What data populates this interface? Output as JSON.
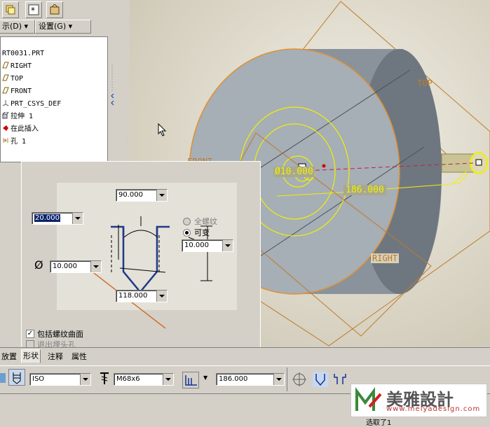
{
  "toolbar": {
    "display_menu": "示(D)",
    "settings_menu": "设置(G)"
  },
  "tree": {
    "items": [
      {
        "label": "RT0031.PRT",
        "icon": "part-icon"
      },
      {
        "label": "RIGHT",
        "icon": "datum-plane-icon"
      },
      {
        "label": "TOP",
        "icon": "datum-plane-icon"
      },
      {
        "label": "FRONT",
        "icon": "datum-plane-icon"
      },
      {
        "label": "PRT_CSYS_DEF",
        "icon": "csys-icon"
      },
      {
        "label": "拉伸 1",
        "icon": "extrude-icon"
      },
      {
        "label": "在此插入",
        "icon": "insert-arrow-icon"
      },
      {
        "label": "孔 1",
        "icon": "hole-icon"
      }
    ]
  },
  "model": {
    "datum_top": "TOP",
    "datum_front": "FRONT",
    "datum_right": "RIGHT",
    "dim_diameter": "Ø10.000",
    "dim_depth": "186.000"
  },
  "dialog": {
    "angle_value": "90.000",
    "thread_depth_value": "20.000",
    "radio_full_thread": "全螺纹",
    "radio_variable": "可变",
    "variable_value": "10.000",
    "diameter_symbol": "Ø",
    "diameter_value": "10.000",
    "drill_angle_value": "118.000",
    "check_include_thread_surface": "包括螺纹曲面",
    "check_exit_countersink": "退出埋头孔"
  },
  "tabs": [
    "放置",
    "形状",
    "注释",
    "属性"
  ],
  "active_tab": "形状",
  "dashboard": {
    "standard_value": "ISO",
    "screw_size_value": "M68x6",
    "depth_value": "186.000"
  },
  "status": {
    "message": "选取了1"
  },
  "logo": {
    "brand": "美雅設計",
    "url": "www.meiyadesign.com"
  },
  "colors": {
    "yellow_sketch": "#f0f000",
    "datum_orange": "#c07a28",
    "model_gray": "#8e969e"
  }
}
